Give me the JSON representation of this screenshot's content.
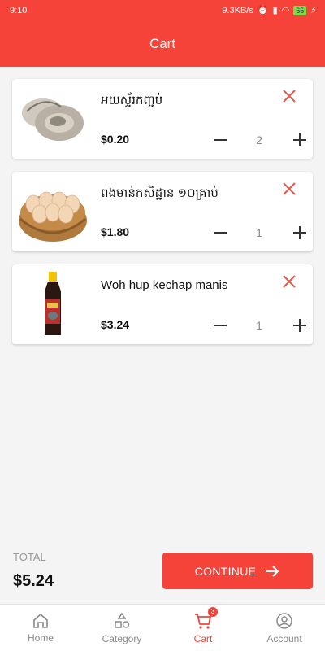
{
  "status_bar": {
    "time": "9:10",
    "network": "9.3KB/s",
    "battery": "65"
  },
  "header": {
    "title": "Cart"
  },
  "cart_items": [
    {
      "name": "អយស្ទ័រកញ្ចប់",
      "price": "$0.20",
      "quantity": "2",
      "image": "oyster"
    },
    {
      "name": "ពងមាន់កសិដ្ឋាន ១០គ្រាប់",
      "price": "$1.80",
      "quantity": "1",
      "image": "eggs-basket"
    },
    {
      "name": "Woh hup kechap manis",
      "price": "$3.24",
      "quantity": "1",
      "image": "sauce-bottle"
    }
  ],
  "footer": {
    "total_label": "TOTAL",
    "total_value": "$5.24",
    "continue_label": "CONTINUE"
  },
  "bottom_nav": [
    {
      "label": "Home",
      "icon": "home-icon"
    },
    {
      "label": "Category",
      "icon": "category-icon"
    },
    {
      "label": "Cart",
      "icon": "cart-icon",
      "badge": "3",
      "active": true
    },
    {
      "label": "Account",
      "icon": "account-icon"
    }
  ],
  "colors": {
    "accent": "#f5433a",
    "remove": "#e05a4f"
  }
}
